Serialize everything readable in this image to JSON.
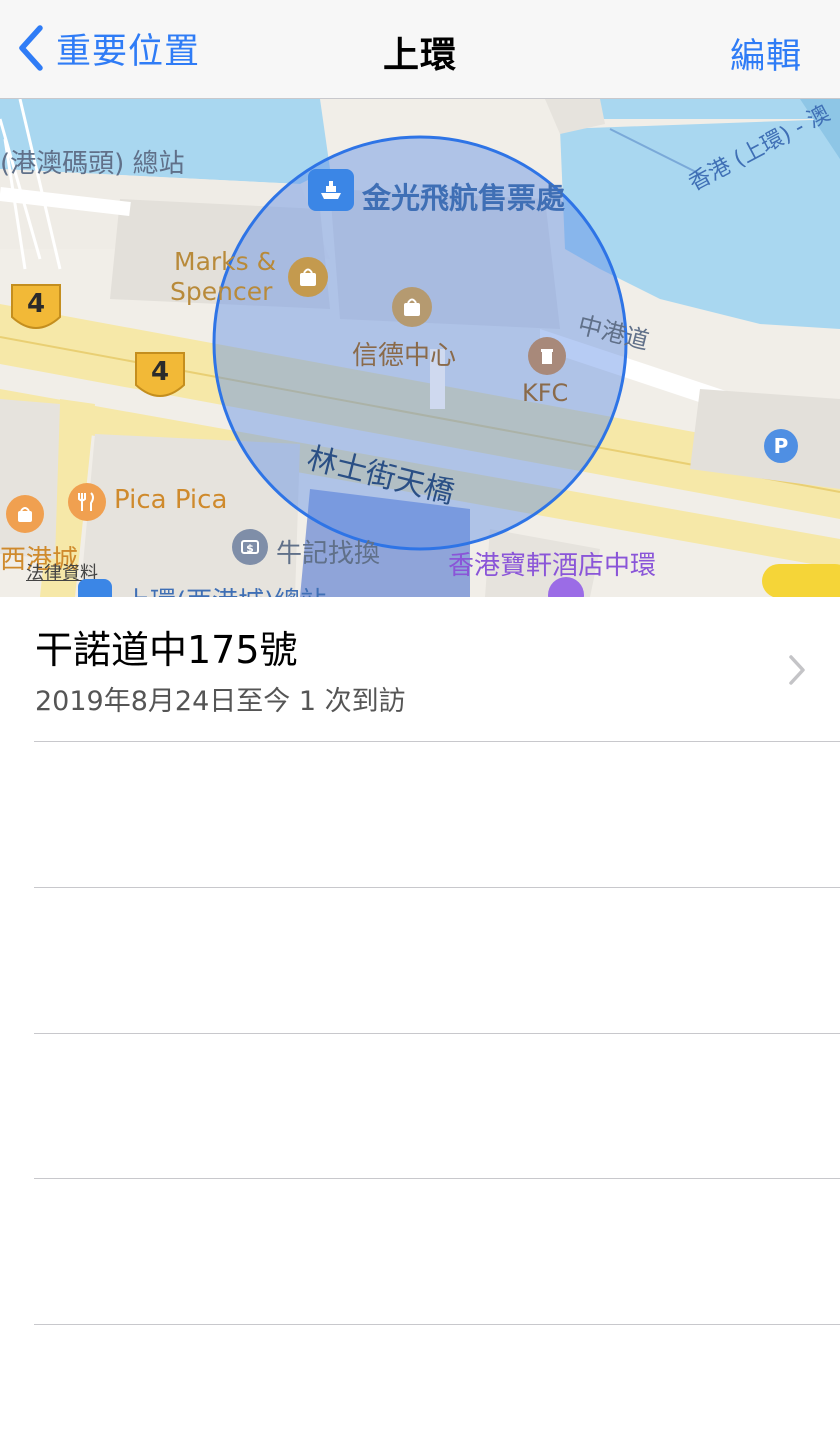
{
  "nav": {
    "back_label": "重要位置",
    "title": "上環",
    "edit_label": "編輯",
    "accent_color": "#2f7cf6"
  },
  "map": {
    "labels": {
      "pier_terminal": "(港澳碼頭) 總站",
      "ferry_ticket": "金光飛航售票處",
      "marks_spencer_1": "Marks &",
      "marks_spencer_2": "Spencer",
      "shun_tak_centre": "信德中心",
      "connaught_rd_central": "中港道",
      "kfc": "KFC",
      "footbridge": "林士街天橋",
      "pica_pica": "Pica Pica",
      "exchange": "牛記找換",
      "hotel": "香港寶軒酒店中環",
      "western_market": "西港城",
      "legal": "法律資料",
      "ferry_route": "香港 (上環) - 澳",
      "route_shield_1": "4",
      "route_shield_2": "4",
      "bus_stop": "上環(西港城)總站"
    },
    "icons": [
      "ferry-icon",
      "shopping-bag-icon",
      "fork-knife-icon",
      "currency-exchange-icon",
      "parking-icon",
      "bed-icon",
      "cup-icon"
    ]
  },
  "list": {
    "item": {
      "title": "干諾道中175號",
      "subtitle": "2019年8月24日至今 1 次到訪"
    }
  }
}
